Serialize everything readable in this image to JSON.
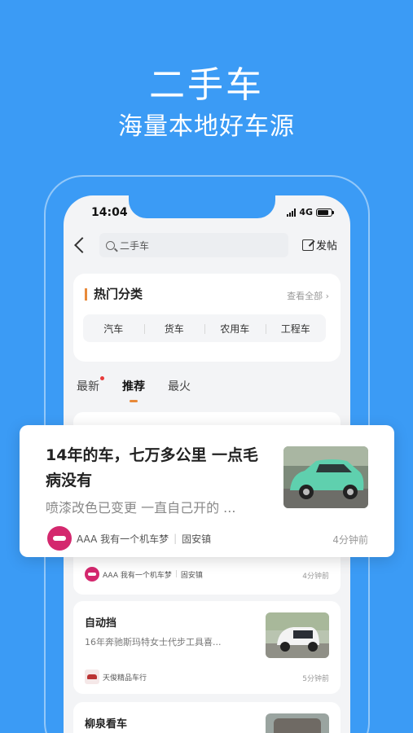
{
  "hero": {
    "title": "二手车",
    "subtitle": "海量本地好车源"
  },
  "status": {
    "time": "14:04",
    "network": "4G"
  },
  "topbar": {
    "search_placeholder": "二手车",
    "post_label": "发帖"
  },
  "hot": {
    "title": "热门分类",
    "view_all": "查看全部",
    "categories": [
      "汽车",
      "货车",
      "农用车",
      "工程车"
    ]
  },
  "tabs": [
    "最新",
    "推荐",
    "最火"
  ],
  "featured": {
    "title": "14年的车，七万多公里 一点毛病没有",
    "desc": "喷漆改色已变更 一直自己开的 ...",
    "user": "AAA 我有一个机车梦",
    "location": "固安镇",
    "time": "4分钟前"
  },
  "list": [
    {
      "user": "AAA 我有一个机车梦",
      "location": "固安镇",
      "time": "4分钟前"
    },
    {
      "title": "自动挡",
      "desc": "16年奔驰斯玛特女士代步工具喜...",
      "user": "天俊精品车行",
      "time": "5分钟前"
    },
    {
      "title": "柳泉看车"
    }
  ],
  "colors": {
    "background": "#3b9bf5",
    "accent": "#e88a3a",
    "avatar": "#d4286e"
  }
}
